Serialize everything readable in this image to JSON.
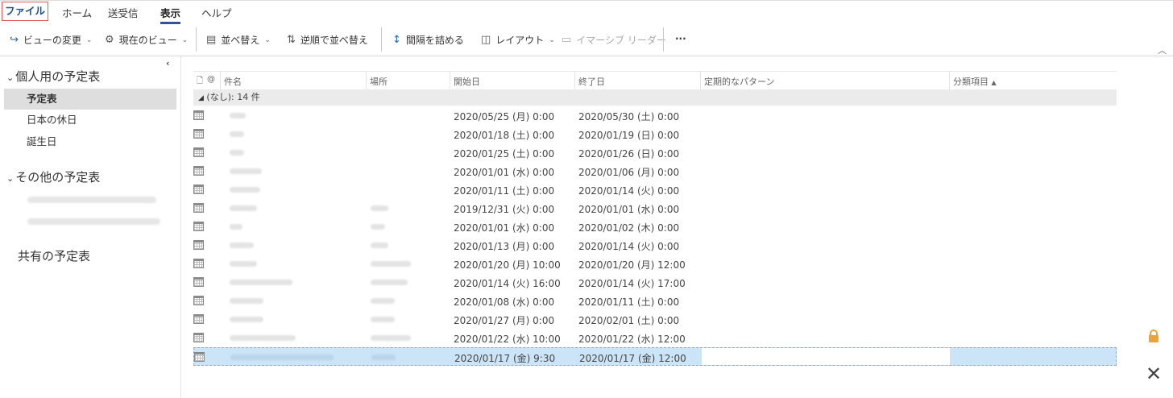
{
  "ribbon": {
    "tabs": [
      "ファイル",
      "ホーム",
      "送受信",
      "表示",
      "ヘルプ"
    ],
    "active_tab": "表示"
  },
  "toolbar": {
    "change_view": "ビューの変更",
    "current_view": "現在のビュー",
    "sort": "並べ替え",
    "reverse_sort": "逆順で並べ替え",
    "compact": "間隔を詰める",
    "layout": "レイアウト",
    "immersive_reader": "イマーシブ リーダー",
    "more": "···"
  },
  "nav": {
    "personal_group": "個人用の予定表",
    "personal_items": [
      "予定表",
      "日本の休日",
      "誕生日"
    ],
    "selected_item": "予定表",
    "other_group": "その他の予定表",
    "shared_group": "共有の予定表"
  },
  "table": {
    "columns": [
      "件名",
      "場所",
      "開始日",
      "終了日",
      "定期的なパターン",
      "分類項目"
    ],
    "sort_indicator": "▲",
    "group_label": "(なし): 14 件",
    "rows": [
      {
        "start": "2020/05/25 (月) 0:00",
        "end": "2020/05/30 (土) 0:00"
      },
      {
        "start": "2020/01/18 (土) 0:00",
        "end": "2020/01/19 (日) 0:00"
      },
      {
        "start": "2020/01/25 (土) 0:00",
        "end": "2020/01/26 (日) 0:00"
      },
      {
        "start": "2020/01/01 (水) 0:00",
        "end": "2020/01/06 (月) 0:00"
      },
      {
        "start": "2020/01/11 (土) 0:00",
        "end": "2020/01/14 (火) 0:00"
      },
      {
        "start": "2019/12/31 (火) 0:00",
        "end": "2020/01/01 (水) 0:00"
      },
      {
        "start": "2020/01/01 (水) 0:00",
        "end": "2020/01/02 (木) 0:00"
      },
      {
        "start": "2020/01/13 (月) 0:00",
        "end": "2020/01/14 (火) 0:00"
      },
      {
        "start": "2020/01/20 (月) 10:00",
        "end": "2020/01/20 (月) 12:00"
      },
      {
        "start": "2020/01/14 (火) 16:00",
        "end": "2020/01/14 (火) 17:00"
      },
      {
        "start": "2020/01/08 (水) 0:00",
        "end": "2020/01/11 (土) 0:00"
      },
      {
        "start": "2020/01/27 (月) 0:00",
        "end": "2020/02/01 (土) 0:00"
      },
      {
        "start": "2020/01/22 (水) 10:00",
        "end": "2020/01/22 (水) 12:00"
      },
      {
        "start": "2020/01/17 (金) 9:30",
        "end": "2020/01/17 (金) 12:00"
      }
    ],
    "selected_row": 13
  },
  "colors": {
    "accent": "#2b579a",
    "file_tab_border": "#e05a5a",
    "selection": "#cce4f7",
    "lock": "#e8a33d"
  }
}
